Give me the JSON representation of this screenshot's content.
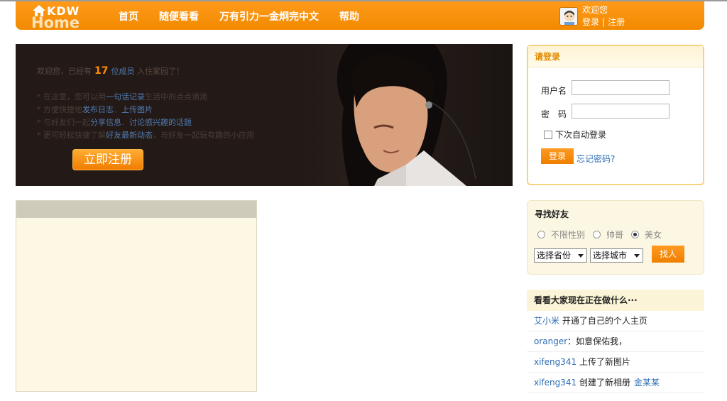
{
  "header": {
    "logo_top": "KDW",
    "logo_bottom": "Home",
    "nav": [
      "首页",
      "随便看看",
      "万有引力一金炯完中文",
      "帮助"
    ],
    "welcome": "欢迎您",
    "login_link": "登录",
    "separator": "|",
    "register_link": "注册"
  },
  "banner": {
    "intro_prefix": "欢迎您，已经有",
    "member_count": "17",
    "member_unit": "位成员",
    "intro_suffix": "入住家园了！",
    "features": [
      {
        "pre": "* 在这里，您可以用",
        "hl": "一句话记录",
        "post": "生活中的点点滴滴",
        "hl2": "",
        "post2": ""
      },
      {
        "pre": "* 方便快捷地",
        "hl": "发布日志",
        "post": "、",
        "hl2": "上传图片",
        "post2": ""
      },
      {
        "pre": "* 与好友们一起",
        "hl": "分享信息",
        "post": "、",
        "hl2": "讨论感兴趣的话题",
        "post2": ""
      },
      {
        "pre": "* 更可轻松快捷了解",
        "hl": "好友最新动态",
        "post": "，与好友一起玩有趣的小应用",
        "hl2": "",
        "post2": ""
      }
    ],
    "register_button": "立即注册"
  },
  "login": {
    "title": "请登录",
    "username_label": "用户名",
    "password_label": "密　码",
    "remember_label": "下次自动登录",
    "login_button": "登录",
    "forgot_link": "忘记密码?"
  },
  "find_friends": {
    "title": "寻找好友",
    "genders": [
      "不限性别",
      "帅哥",
      "美女"
    ],
    "selected_gender": "美女",
    "province_select": "选择省份",
    "city_select": "选择城市",
    "find_button": "找人"
  },
  "feed": {
    "title": "看看大家现在正在做什么···",
    "items": [
      {
        "user": "艾小米",
        "action": " 开通了自己的个人主页",
        "extra": ""
      },
      {
        "user": "oranger",
        "action": "：如意保佑我，",
        "extra": ""
      },
      {
        "user": "xifeng341",
        "action": " 上传了新图片",
        "extra": ""
      },
      {
        "user": "xifeng341",
        "action": " 创建了新相册",
        "extra": "金某某"
      }
    ]
  },
  "colors": {
    "brand_orange": "#f28a00",
    "link_blue": "#2e6db3",
    "panel_cream": "#fcf8e3"
  }
}
